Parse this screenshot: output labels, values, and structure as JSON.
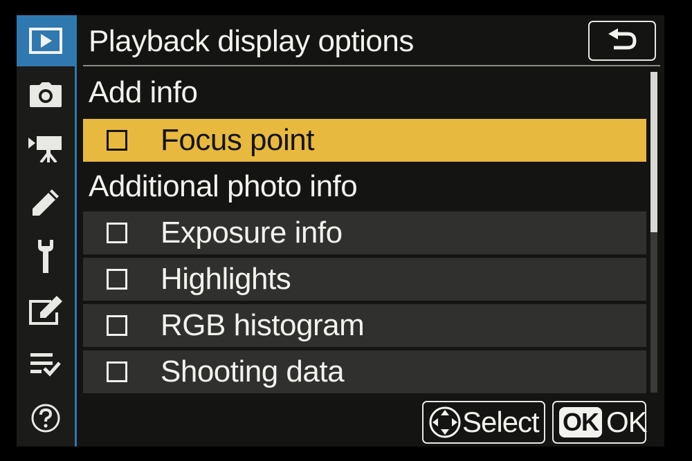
{
  "header": {
    "title": "Playback display options",
    "back_icon": "back-arrow-icon"
  },
  "sidebar": {
    "items": [
      {
        "icon": "playback-icon",
        "active": true
      },
      {
        "icon": "camera-icon",
        "active": false
      },
      {
        "icon": "movie-camera-icon",
        "active": false
      },
      {
        "icon": "pencil-icon",
        "active": false
      },
      {
        "icon": "wrench-icon",
        "active": false
      },
      {
        "icon": "retouch-icon",
        "active": false
      },
      {
        "icon": "my-menu-icon",
        "active": false
      },
      {
        "icon": "help-icon",
        "active": false
      }
    ]
  },
  "list": {
    "section1_label": "Add info",
    "section2_label": "Additional photo info",
    "items": [
      {
        "label": "Focus point",
        "checked": false,
        "selected": true
      },
      {
        "label": "Exposure info",
        "checked": false,
        "selected": false
      },
      {
        "label": "Highlights",
        "checked": false,
        "selected": false
      },
      {
        "label": "RGB histogram",
        "checked": false,
        "selected": false
      },
      {
        "label": "Shooting data",
        "checked": false,
        "selected": false
      }
    ]
  },
  "footer": {
    "select_label": "Select",
    "ok_badge": "OK",
    "ok_label": "OK"
  },
  "colors": {
    "accent_blue": "#2f79b0",
    "highlight_yellow": "#e8b93f",
    "row_gray": "#30312e",
    "background": "#141412"
  }
}
